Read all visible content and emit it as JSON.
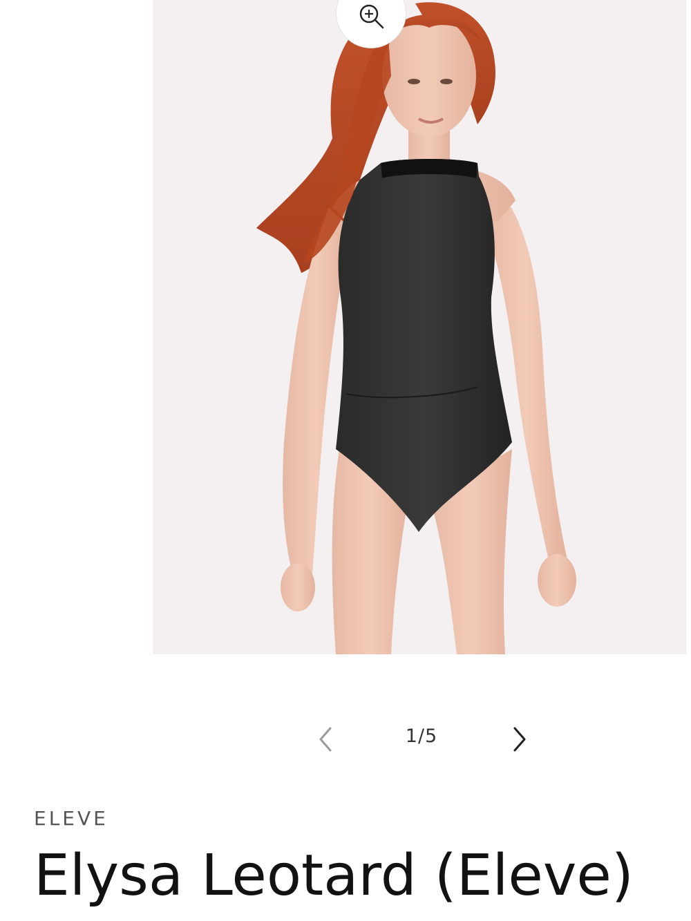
{
  "gallery": {
    "zoom_icon": "zoom-in-icon",
    "image_alt": "Model wearing black halter-neck leotard",
    "prev_icon": "chevron-left-icon",
    "next_icon": "chevron-right-icon",
    "counter": "1/5",
    "current_index": 1,
    "total_images": 5
  },
  "product": {
    "vendor": "ELEVE",
    "title": "Elysa Leotard (Eleve)"
  },
  "colors": {
    "image_background": "#f4f0f2",
    "text_primary": "#121212",
    "text_secondary": "#555555"
  }
}
